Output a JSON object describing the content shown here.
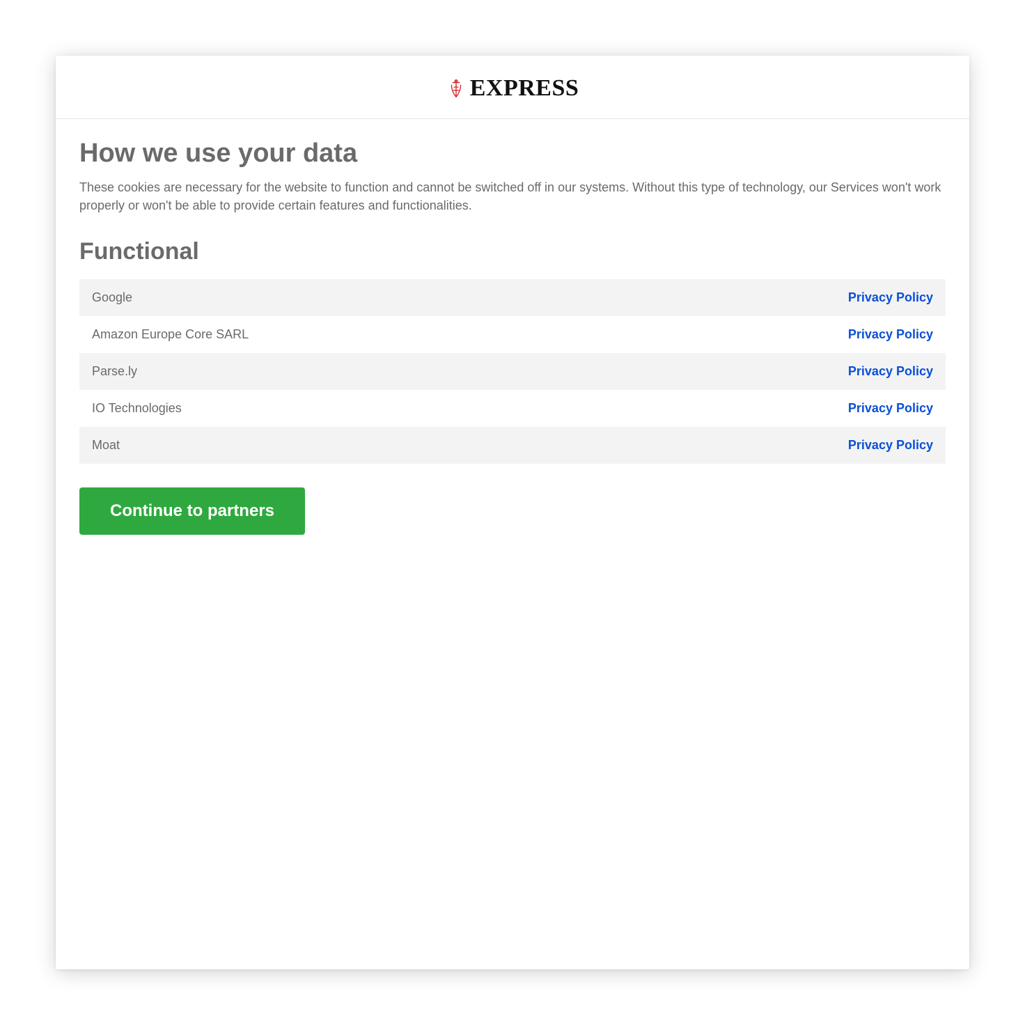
{
  "brand": {
    "name": "EXPRESS"
  },
  "page": {
    "title": "How we use your data",
    "description": "These cookies are necessary for the website to function and cannot be switched off in our systems. Without this type of technology, our Services won't work properly or won't be able to provide certain features and functionalities."
  },
  "section": {
    "heading": "Functional",
    "link_label": "Privacy Policy",
    "vendors": [
      {
        "name": "Google"
      },
      {
        "name": "Amazon Europe Core SARL"
      },
      {
        "name": "Parse.ly"
      },
      {
        "name": "IO Technologies"
      },
      {
        "name": "Moat"
      }
    ]
  },
  "cta": {
    "label": "Continue to partners"
  },
  "colors": {
    "accent_green": "#2fa93f",
    "link_blue": "#0a4fd6",
    "text_grey": "#6a6a6a",
    "row_alt": "#f3f3f3"
  }
}
